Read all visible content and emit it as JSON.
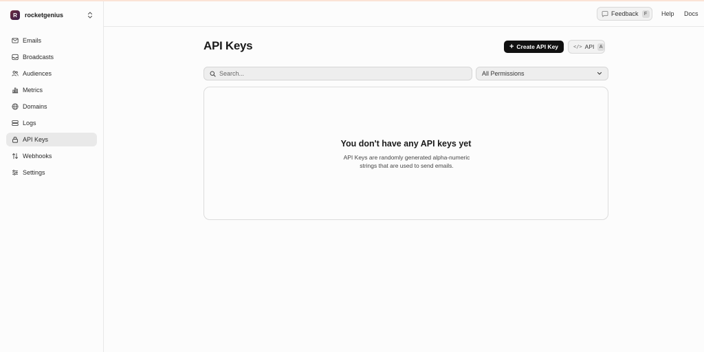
{
  "sidebar": {
    "workspace": {
      "initial": "R",
      "name": "rocketgenius"
    },
    "items": [
      {
        "label": "Emails",
        "icon": "mail-icon"
      },
      {
        "label": "Broadcasts",
        "icon": "inbox-icon"
      },
      {
        "label": "Audiences",
        "icon": "users-icon"
      },
      {
        "label": "Metrics",
        "icon": "bar-chart-icon"
      },
      {
        "label": "Domains",
        "icon": "globe-icon"
      },
      {
        "label": "Logs",
        "icon": "logs-icon"
      },
      {
        "label": "API Keys",
        "icon": "lock-icon",
        "active": true
      },
      {
        "label": "Webhooks",
        "icon": "webhook-arrows-icon"
      },
      {
        "label": "Settings",
        "icon": "sliders-icon"
      }
    ]
  },
  "header": {
    "feedback": {
      "label": "Feedback",
      "shortcut": "F"
    },
    "help": "Help",
    "docs": "Docs"
  },
  "main": {
    "title": "API Keys",
    "create_button": "Create API Key",
    "api_button": {
      "label": "API",
      "shortcut": "A"
    },
    "search": {
      "placeholder": "Search...",
      "value": ""
    },
    "permissions_filter": {
      "selected": "All Permissions"
    },
    "empty_state": {
      "title": "You don't have any API keys yet",
      "description": "API Keys are randomly generated alpha-numeric strings that are used to send emails."
    }
  },
  "colors": {
    "accent_top_border": "#fbe3d6",
    "primary_button": "#111111",
    "active_nav_bg": "#e9e9e9"
  }
}
